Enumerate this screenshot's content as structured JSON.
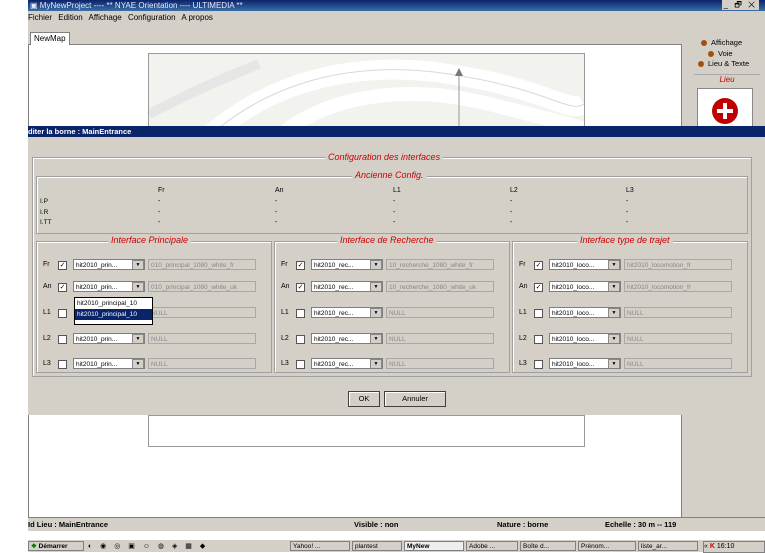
{
  "window": {
    "title": "MyNewProject ---- ** NYAE Orientation ---- ULTIMEDIA **",
    "controls": "_ 🗗 ✕"
  },
  "menu": [
    "Fichier",
    "Edition",
    "Affichage",
    "Configuration",
    "A propos"
  ],
  "tab": {
    "label": "NewMap"
  },
  "right_panel": {
    "items": [
      "Affichage",
      "Voie",
      "Lieu & Texte"
    ],
    "lieu_legend": "Lieu"
  },
  "dialog": {
    "title": "diter la borne : MainEntrance",
    "main_legend": "Configuration des interfaces",
    "old_config_legend": "Ancienne Config.",
    "columns": [
      "Fr",
      "An",
      "L1",
      "L2",
      "L3"
    ],
    "rows": [
      {
        "label": "I.P",
        "values": [
          "-",
          "-",
          "-",
          "-",
          "-"
        ]
      },
      {
        "label": "I.R",
        "values": [
          "-",
          "-",
          "-",
          "-",
          "-"
        ]
      },
      {
        "label": "I.TT",
        "values": [
          "-",
          "-",
          "-",
          "-",
          "-"
        ]
      }
    ],
    "groups": [
      {
        "legend": "Interface Principale",
        "rows": [
          {
            "lang": "Fr",
            "checked": true,
            "combo": "hit2010_prin...",
            "field": "010_principal_1080_white_fr"
          },
          {
            "lang": "An",
            "checked": true,
            "combo": "hit2010_prin...",
            "field": "010_principal_1080_white_uk"
          },
          {
            "lang": "L1",
            "checked": false,
            "combo": "",
            "field": "NULL"
          },
          {
            "lang": "L2",
            "checked": false,
            "combo": "hit2010_prin...",
            "field": "NULL"
          },
          {
            "lang": "L3",
            "checked": false,
            "combo": "hit2010_prin...",
            "field": "NULL"
          }
        ]
      },
      {
        "legend": "Interface de Recherche",
        "rows": [
          {
            "lang": "Fr",
            "checked": true,
            "combo": "hit2010_rec...",
            "field": "10_recherche_1080_white_fr"
          },
          {
            "lang": "An",
            "checked": true,
            "combo": "hit2010_rec...",
            "field": "10_recherche_1080_white_uk"
          },
          {
            "lang": "L1",
            "checked": false,
            "combo": "hit2010_rec...",
            "field": "NULL"
          },
          {
            "lang": "L2",
            "checked": false,
            "combo": "hit2010_rec...",
            "field": "NULL"
          },
          {
            "lang": "L3",
            "checked": false,
            "combo": "hit2010_rec...",
            "field": "NULL"
          }
        ]
      },
      {
        "legend": "Interface type de trajet",
        "rows": [
          {
            "lang": "Fr",
            "checked": true,
            "combo": "hit2010_loco...",
            "field": "hit2010_locomotion_fr"
          },
          {
            "lang": "An",
            "checked": true,
            "combo": "hit2010_loco...",
            "field": "hit2010_locomotion_fr"
          },
          {
            "lang": "L1",
            "checked": false,
            "combo": "hit2010_loco...",
            "field": "NULL"
          },
          {
            "lang": "L2",
            "checked": false,
            "combo": "hit2010_loco...",
            "field": "NULL"
          },
          {
            "lang": "L3",
            "checked": false,
            "combo": "hit2010_loco...",
            "field": "NULL"
          }
        ]
      }
    ],
    "dropdown_options": [
      "hit2010_principal_10",
      "hit2010_principal_10"
    ],
    "ok_label": "OK",
    "cancel_label": "Annuler"
  },
  "status": {
    "lieu": "Id Lieu : MainEntrance",
    "visible": "Visible : non",
    "nature": "Nature : borne",
    "echelle": "Echelle : 30 m -- 119"
  },
  "taskbar": {
    "start": "Démarrer",
    "buttons": [
      "Yahoo! ...",
      "plantest",
      "MyNew",
      "Adobe ...",
      "Boîte d...",
      "Prénom...",
      "liste_ar..."
    ],
    "clock": "16:10",
    "tray_chevron": "«"
  },
  "colors": {
    "title_bar": "#0a246a",
    "legend_red": "#cc0000",
    "dialog_bg": "#d4d0c8"
  }
}
